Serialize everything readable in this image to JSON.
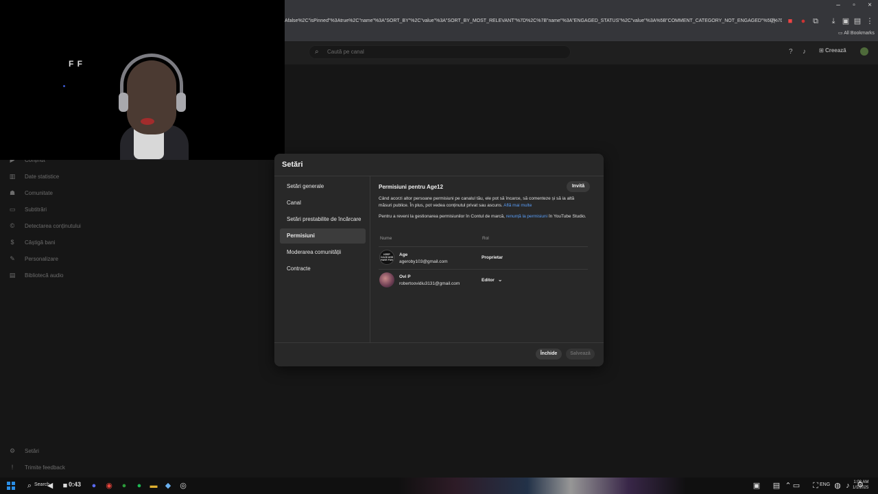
{
  "browser": {
    "url": "Afalse%2C\"isPinned\"%3Atrue%2C\"name\"%3A\"SORT_BY\"%2C\"value\"%3A\"SORT_BY_MOST_RELEVANT\"%7D%2C%7B\"name\"%3A\"ENGAGED_STATUS\"%2C\"value\"%3A%5B\"COMMENT_CATEGORY_NOT_ENGAGED\"%5D%7D%5D",
    "bookmarks_label": "All Bookmarks"
  },
  "header": {
    "search_placeholder": "Caută pe canal",
    "create_label": "Creează"
  },
  "sidebar": {
    "items": [
      {
        "label": "Conținut",
        "icon": "content-icon"
      },
      {
        "label": "Date statistice",
        "icon": "analytics-icon"
      },
      {
        "label": "Comunitate",
        "icon": "community-icon"
      },
      {
        "label": "Subtitrări",
        "icon": "subtitles-icon"
      },
      {
        "label": "Detectarea conținutului",
        "icon": "copyright-icon"
      },
      {
        "label": "Câștigă bani",
        "icon": "dollar-icon"
      },
      {
        "label": "Personalizare",
        "icon": "wand-icon"
      },
      {
        "label": "Bibliotecă audio",
        "icon": "audio-library-icon"
      }
    ],
    "settings_label": "Setări",
    "feedback_label": "Trimite feedback"
  },
  "webcam": {
    "glyphs": "F F"
  },
  "dialog": {
    "title": "Setări",
    "nav": [
      "Setări generale",
      "Canal",
      "Setări prestabilite de încărcare",
      "Permisiuni",
      "Moderarea comunității",
      "Contracte"
    ],
    "active_nav": "Permisiuni",
    "permissions": {
      "title": "Permisiuni pentru Age12",
      "invite_label": "Invită",
      "desc": "Când acorzi altor persoane permisiuni pe canalul tău, ele pot să încarce, să comenteze și să ia altă măsuri publice. În plus, pot vedea conținutul privat sau ascuns.",
      "learn_more": "Află mai multe",
      "note_prefix": "Pentru a reveni la gestionarea permisiunilor în Contul de marcă,",
      "note_link": "renunță la permisiuni",
      "note_suffix": "în YouTube Studio.",
      "col_name": "Nume",
      "col_role": "Rol",
      "users": [
        {
          "name": "Age",
          "email": "ageroby103@gmail.com",
          "role": "Proprietar",
          "avatar_text": "KEEP CALM AND HAVE FUN"
        },
        {
          "name": "Ovi P",
          "email": "robertoovidiu3131@gmail.com",
          "role": "Editor"
        }
      ]
    },
    "close_label": "Închide",
    "save_label": "Salvează"
  },
  "taskbar": {
    "search_label": "Search",
    "timer_label": "0:43",
    "lang": "ENG",
    "time": "1:08 AM",
    "date": "1/1/2025"
  },
  "colors": {
    "link": "#5a9ef7",
    "dialog_bg": "#282828",
    "page_bg": "#0f0f0f"
  }
}
